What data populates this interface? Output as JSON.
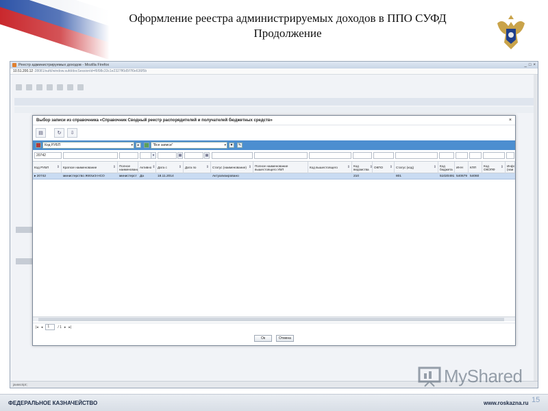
{
  "slide": {
    "title_line1": "Оформление реестра администрируемых доходов в ППО СУФД",
    "title_line2": "Продолжение",
    "footer_left": "ФЕДЕРАЛЬНОЕ КАЗНАЧЕЙСТВО",
    "footer_right": "www.roskazna.ru",
    "page_number": "15",
    "watermark": "MyShared"
  },
  "browser": {
    "window_title": "Реестр администрируемых доходов - Mozilla Firefox",
    "url_host": "10.51.200.12",
    "url_rest": ":28081/sufd/window.sufd/docSessionId=f6f98c33c1e2327ff0d5f7f0e636f5b",
    "status_text": "javascript:;"
  },
  "dialog": {
    "title": "Выбор записи из справочника «Справочник Сводный реестр распорядителей и получателей бюджетных средств»",
    "close": "×",
    "filter_field": "Код РУБП",
    "filter_mode": "\"Все записи\"",
    "search_value": "20742",
    "columns": [
      "Код РУБП",
      "Краткое наименование",
      "Полное наименовани",
      "Активно",
      "Дата с",
      "Дата по",
      "Статус (наименование)",
      "Полное наименование вышестоящего УБП",
      "Код вышестоящего",
      "Код ведомства",
      "ОКПО",
      "Статус (код)",
      "Код бюджета",
      "ИНН",
      "КПП",
      "Код ОКОПФ",
      "Инфо (наи"
    ],
    "row": [
      "20742",
      "министерство ЖКХиЭ НСО",
      "министерст",
      "Да",
      "18.11.2014",
      "",
      "Актуализировано",
      "",
      "",
      "210",
      "",
      "801",
      "51020491",
      "540679",
      "54060",
      "",
      ""
    ],
    "pager": {
      "page": "1",
      "of": "/ 1"
    },
    "ok_label": "Ок",
    "cancel_label": "Отмена"
  }
}
